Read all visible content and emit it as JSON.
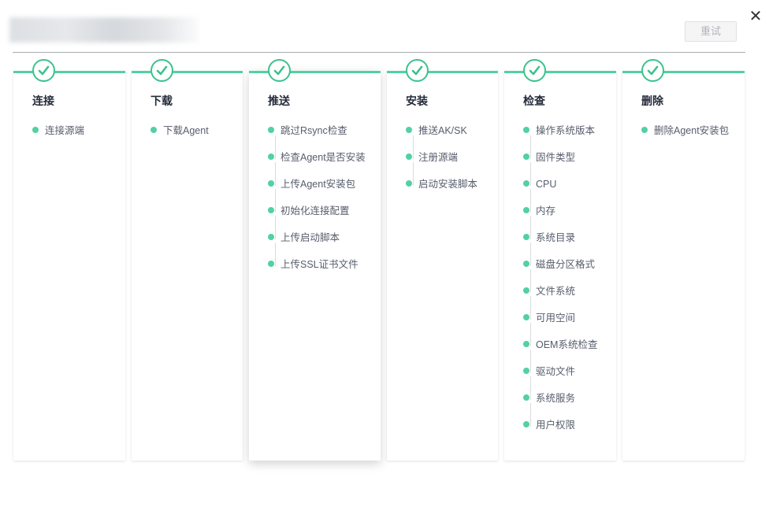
{
  "header": {
    "retry_label": "重试",
    "close_icon": "close-icon"
  },
  "colors": {
    "accent": "#52d1a3",
    "check_border": "#3cc28f"
  },
  "stages": [
    {
      "title": "连接",
      "status": "done",
      "steps": [
        "连接源端"
      ]
    },
    {
      "title": "下载",
      "status": "done",
      "steps": [
        "下载Agent"
      ]
    },
    {
      "title": "推送",
      "status": "done",
      "steps": [
        "跳过Rsync检查",
        "检查Agent是否安装",
        "上传Agent安装包",
        "初始化连接配置",
        "上传启动脚本",
        "上传SSL证书文件"
      ]
    },
    {
      "title": "安装",
      "status": "done",
      "steps": [
        "推送AK/SK",
        "注册源端",
        "启动安装脚本"
      ]
    },
    {
      "title": "检查",
      "status": "done",
      "steps": [
        "操作系统版本",
        "固件类型",
        "CPU",
        "内存",
        "系统目录",
        "磁盘分区格式",
        "文件系统",
        "可用空间",
        "OEM系统检查",
        "驱动文件",
        "系统服务",
        "用户权限"
      ]
    },
    {
      "title": "删除",
      "status": "done",
      "steps": [
        "删除Agent安装包"
      ]
    }
  ]
}
